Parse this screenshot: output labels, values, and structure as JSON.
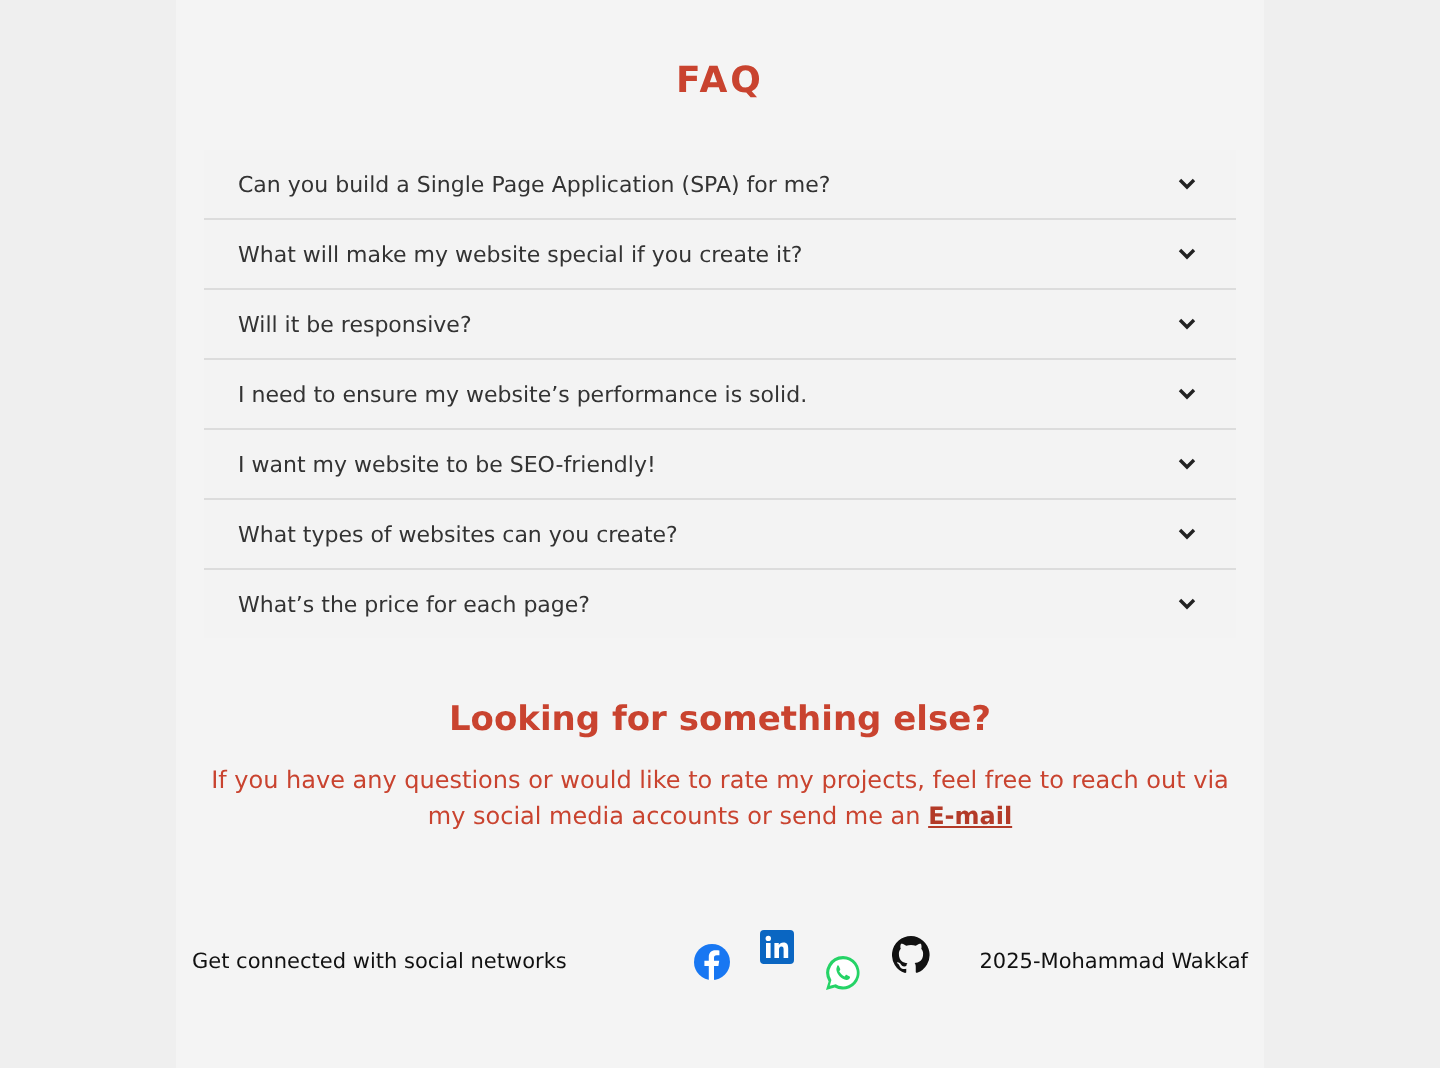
{
  "faq": {
    "title": "FAQ",
    "items": [
      {
        "question": "Can you build a Single Page Application (SPA) for me?",
        "expanded": false
      },
      {
        "question": "What will make my website special if you create it?",
        "expanded": false
      },
      {
        "question": "Will it be responsive?",
        "expanded": false
      },
      {
        "question": "I need to ensure my website’s performance is solid.",
        "expanded": false
      },
      {
        "question": "I want my website to be SEO-friendly!",
        "expanded": false
      },
      {
        "question": "What types of websites can you create?",
        "expanded": false
      },
      {
        "question": "What’s the price for each page?",
        "expanded": false
      }
    ]
  },
  "contact": {
    "title": "Looking for something else?",
    "text": "If you have any questions or would like to rate my projects, feel free to reach out via my social media accounts or send me an",
    "link": "E-mail"
  },
  "footer": {
    "label": "Get connected with social networks",
    "social_links": [
      {
        "kind": "facebook"
      },
      {
        "kind": "linkedin"
      },
      {
        "kind": "whatsapp"
      },
      {
        "kind": "github"
      }
    ],
    "copyright": "2025-Mohammad Wakkaf"
  }
}
